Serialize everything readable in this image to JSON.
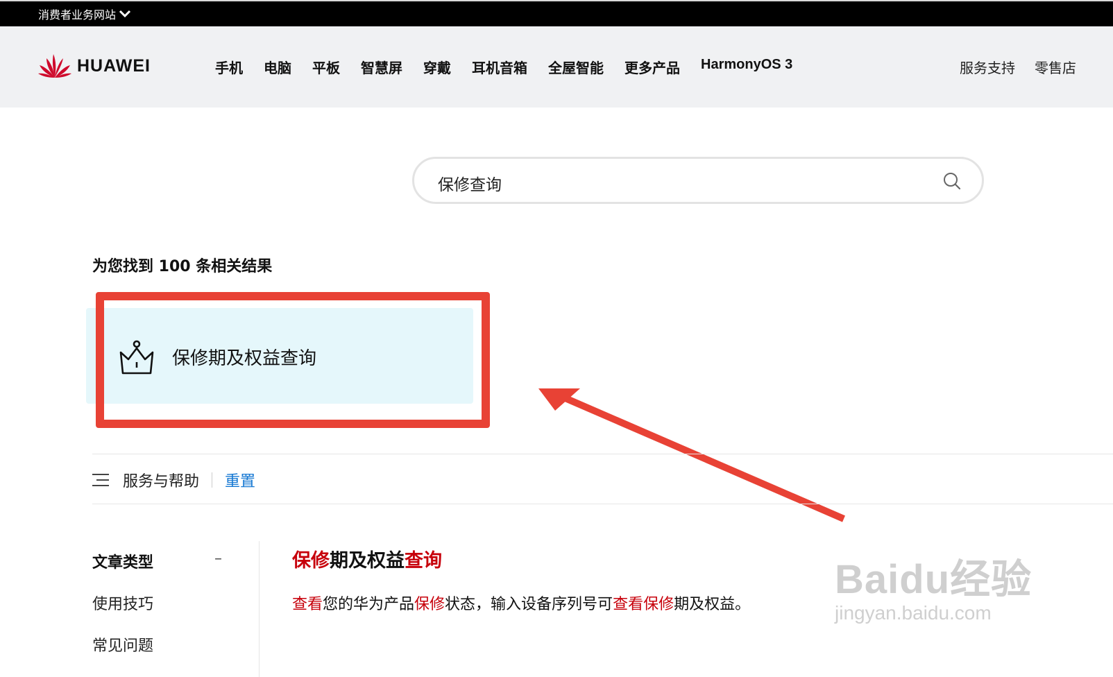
{
  "topbar": {
    "site_label": "消费者业务网站"
  },
  "header": {
    "brand": "HUAWEI",
    "nav": [
      "手机",
      "电脑",
      "平板",
      "智慧屏",
      "穿戴",
      "耳机音箱",
      "全屋智能",
      "更多产品",
      "HarmonyOS 3"
    ],
    "nav_right": [
      "服务支持",
      "零售店"
    ]
  },
  "search": {
    "value": "保修查询"
  },
  "results": {
    "count_text": "为您找到 100 条相关结果",
    "featured": {
      "title": "保修期及权益查询",
      "icon": "crown-icon"
    }
  },
  "filter": {
    "label": "服务与帮助",
    "reset": "重置"
  },
  "sidebar": {
    "title": "文章类型",
    "collapse": "–",
    "items": [
      "使用技巧",
      "常见问题"
    ]
  },
  "result_item": {
    "title_parts": [
      "保修",
      "期及权益",
      "查询"
    ],
    "desc_parts": [
      "查看",
      "您的华为产品",
      "保修",
      "状态，输入设备序列号可",
      "查看",
      "保修",
      "期及权益。"
    ]
  },
  "watermark": {
    "line1": "Bai",
    "line1b": "du",
    "line1c": "经验",
    "line2": "jingyan.baidu.com"
  },
  "colors": {
    "highlight": "#c7000b",
    "annotation": "#e84235",
    "link": "#1678d3",
    "card_bg": "#e5f7fb"
  }
}
